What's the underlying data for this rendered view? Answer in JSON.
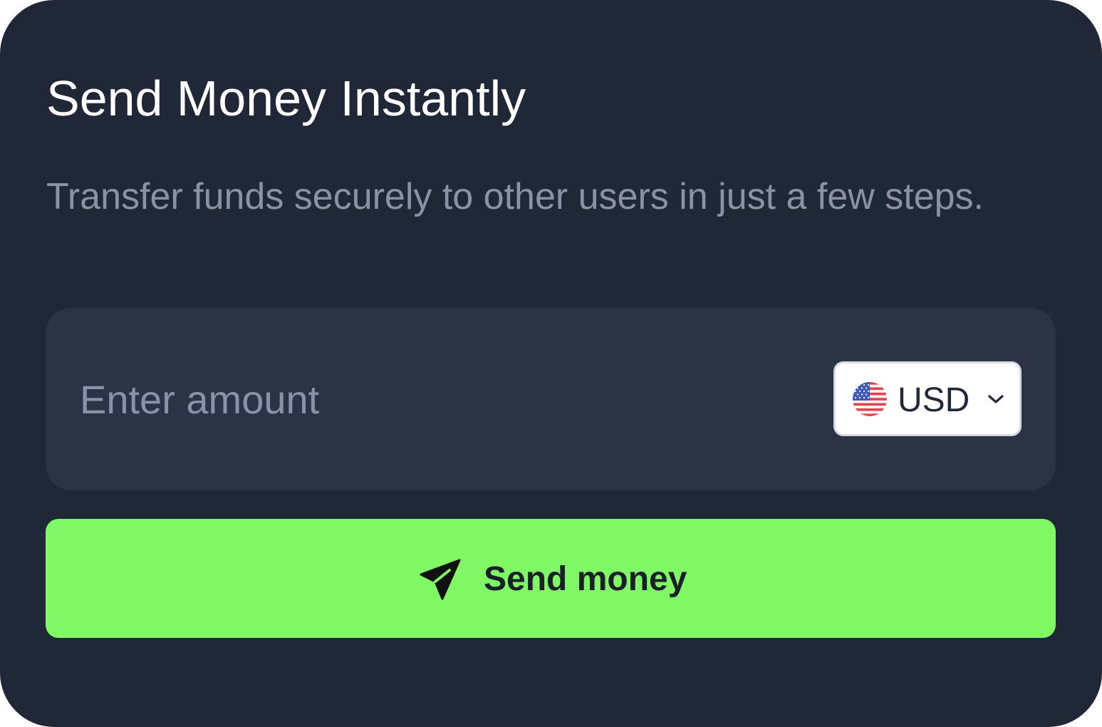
{
  "card": {
    "title": "Send Money Instantly",
    "subtitle": "Transfer funds securely to other users in just a few steps."
  },
  "amount": {
    "placeholder": "Enter amount",
    "value": ""
  },
  "currency": {
    "code": "USD",
    "flag_icon": "us-flag-icon",
    "dropdown_icon": "chevron-down-icon"
  },
  "send_button": {
    "label": "Send money",
    "icon": "send-plane-icon"
  },
  "colors": {
    "card_background": "#202737",
    "input_background": "#2c3344",
    "accent": "#80f765",
    "title_text": "#ffffff",
    "muted_text": "#8a93a6"
  }
}
